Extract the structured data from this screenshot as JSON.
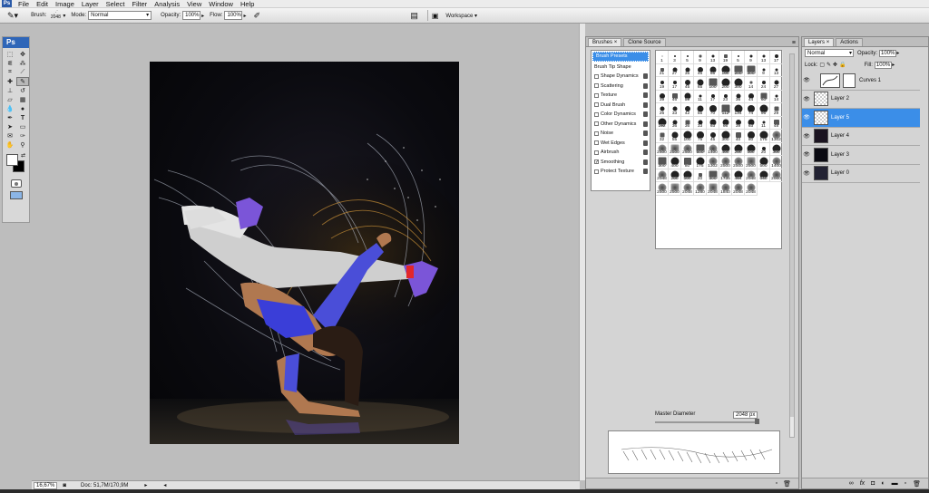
{
  "menubar": {
    "items": [
      "File",
      "Edit",
      "Image",
      "Layer",
      "Select",
      "Filter",
      "Analysis",
      "View",
      "Window",
      "Help"
    ]
  },
  "options": {
    "brush_label": "Brush:",
    "brush_size": "2048",
    "mode_label": "Mode:",
    "mode_value": "Normal",
    "opacity_label": "Opacity:",
    "opacity_value": "100%",
    "flow_label": "Flow:",
    "flow_value": "100%",
    "workspace_label": "Workspace"
  },
  "toolbox": {
    "logo": "Ps"
  },
  "status": {
    "zoom": "16,67%",
    "doc": "Doc: 51,7M/170,9M"
  },
  "brushes_panel": {
    "tabs": [
      "Brushes",
      "Clone Source"
    ],
    "options": [
      {
        "label": "Brush Presets",
        "checkbox": false,
        "checked": false,
        "selected": true,
        "lock": false
      },
      {
        "label": "Brush Tip Shape",
        "checkbox": false,
        "checked": false,
        "selected": false,
        "lock": false
      },
      {
        "label": "Shape Dynamics",
        "checkbox": true,
        "checked": false,
        "selected": false,
        "lock": true
      },
      {
        "label": "Scattering",
        "checkbox": true,
        "checked": false,
        "selected": false,
        "lock": true
      },
      {
        "label": "Texture",
        "checkbox": true,
        "checked": false,
        "selected": false,
        "lock": true
      },
      {
        "label": "Dual Brush",
        "checkbox": true,
        "checked": false,
        "selected": false,
        "lock": true
      },
      {
        "label": "Color Dynamics",
        "checkbox": true,
        "checked": false,
        "selected": false,
        "lock": true
      },
      {
        "label": "Other Dynamics",
        "checkbox": true,
        "checked": false,
        "selected": false,
        "lock": true
      },
      {
        "label": "Noise",
        "checkbox": true,
        "checked": false,
        "selected": false,
        "lock": true
      },
      {
        "label": "Wet Edges",
        "checkbox": true,
        "checked": false,
        "selected": false,
        "lock": true
      },
      {
        "label": "Airbrush",
        "checkbox": true,
        "checked": false,
        "selected": false,
        "lock": true
      },
      {
        "label": "Smoothing",
        "checkbox": true,
        "checked": true,
        "selected": false,
        "lock": true
      },
      {
        "label": "Protect Texture",
        "checkbox": true,
        "checked": false,
        "selected": false,
        "lock": true
      }
    ],
    "brush_sizes": [
      "1",
      "3",
      "5",
      "9",
      "13",
      "19",
      "5",
      "9",
      "13",
      "17",
      "21",
      "27",
      "35",
      "45",
      "65",
      "100",
      "200",
      "300",
      "9",
      "13",
      "19",
      "17",
      "45",
      "65",
      "100",
      "200",
      "300",
      "14",
      "24",
      "27",
      "39",
      "46",
      "59",
      "11",
      "17",
      "23",
      "36",
      "44",
      "60",
      "14",
      "26",
      "33",
      "42",
      "55",
      "70",
      "112",
      "134",
      "74",
      "95",
      "29",
      "192",
      "36",
      "36",
      "33",
      "63",
      "66",
      "39",
      "63",
      "11",
      "48",
      "32",
      "55",
      "100",
      "75",
      "45",
      "300",
      "40",
      "80",
      "175",
      "1302",
      "2500",
      "2500",
      "2500",
      "500",
      "1400",
      "400",
      "200",
      "500",
      "20",
      "300",
      "300",
      "400",
      "80",
      "175",
      "1302",
      "2500",
      "2500",
      "2500",
      "500",
      "1400",
      "2048",
      "200",
      "500",
      "20",
      "300",
      "1735",
      "464",
      "2048",
      "640",
      "2000",
      "2500",
      "2500",
      "2048",
      "1280",
      "2048",
      "1840",
      "2048",
      "2048"
    ],
    "master_diameter_label": "Master Diameter",
    "master_diameter_value": "2048 px"
  },
  "layers_panel": {
    "tabs": [
      "Layers",
      "Actions"
    ],
    "blend_mode": "Normal",
    "opacity_label": "Opacity:",
    "opacity_value": "100%",
    "lock_label": "Lock:",
    "fill_label": "Fill:",
    "fill_value": "100%",
    "layers": [
      {
        "name": "Curves 1",
        "selected": false
      },
      {
        "name": "Layer 2",
        "selected": false
      },
      {
        "name": "Layer 5",
        "selected": true
      },
      {
        "name": "Layer 4",
        "selected": false
      },
      {
        "name": "Layer 3",
        "selected": false
      },
      {
        "name": "Layer 0",
        "selected": false
      }
    ]
  }
}
